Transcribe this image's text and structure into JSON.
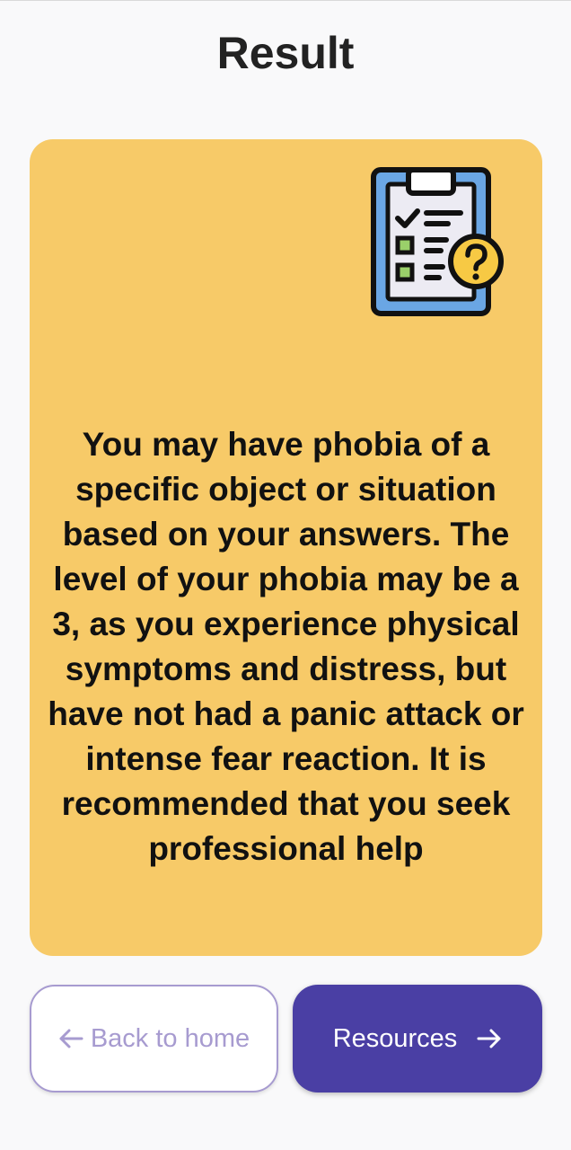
{
  "header": {
    "title": "Result"
  },
  "card": {
    "illustration_icon": "clipboard-checklist-question-icon",
    "result_text": "You may have phobia of a specific object or situation based on your answers. The level of your phobia may be a 3, as you experience physical symptoms and distress, but have not had a panic attack or intense fear reaction. It is recommended that you seek professional help"
  },
  "buttons": {
    "back_label": "Back to home",
    "back_icon": "arrow-left-icon",
    "resources_label": "Resources",
    "resources_icon": "arrow-right-icon"
  },
  "colors": {
    "background": "#f9f9fa",
    "card": "#f7ca68",
    "primary": "#4a3fa4",
    "secondary_border": "#a79bd0"
  }
}
